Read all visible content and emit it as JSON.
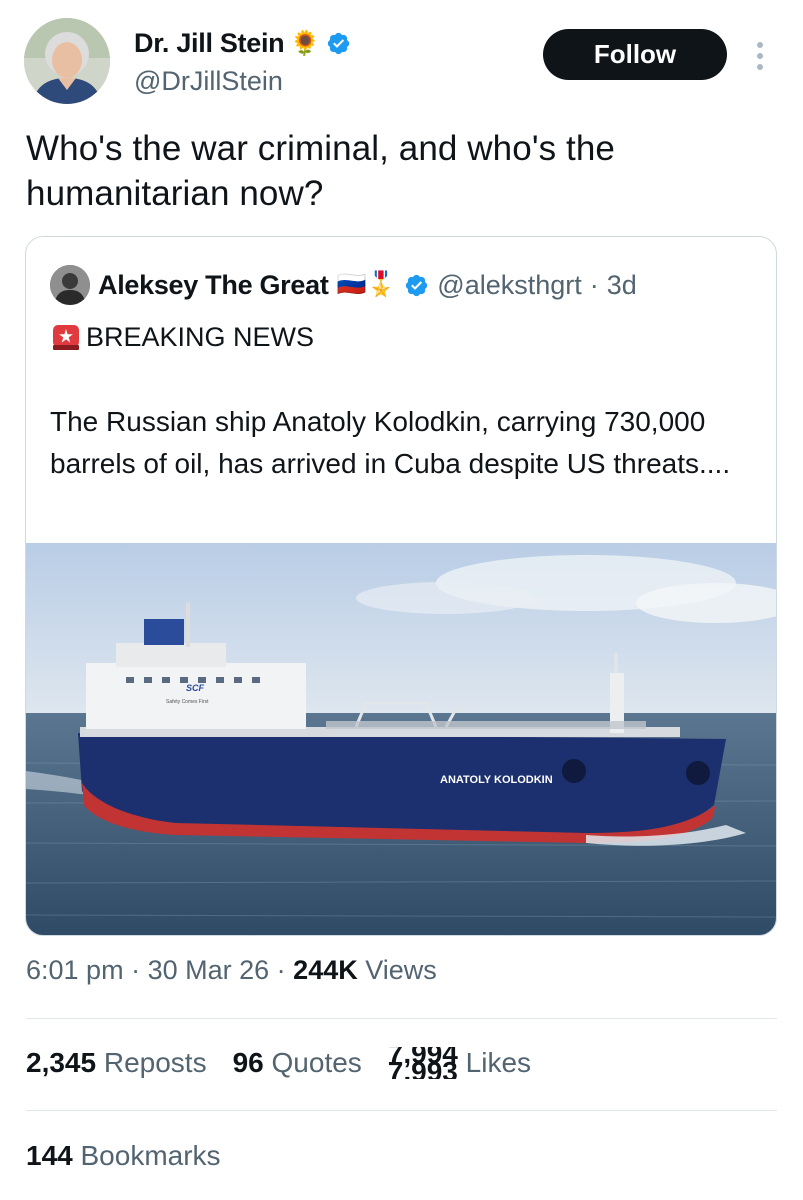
{
  "author": {
    "name": "Dr. Jill Stein",
    "name_emoji": "🌻",
    "handle": "@DrJillStein",
    "verified": true
  },
  "follow_label": "Follow",
  "tweet_text": "Who's the war criminal, and who's the humanitarian now?",
  "quoted": {
    "name": "Aleksey The Great",
    "name_emojis": "🇷🇺🎖️",
    "verified": true,
    "handle": "@aleksthgrt",
    "age": "3d",
    "heading_emoji": "🚨",
    "heading": "BREAKING NEWS",
    "body": "The Russian ship Anatoly Kolodkin, carrying 730,000 barrels of oil, has arrived in Cuba despite US threats....",
    "image_text": {
      "hull_name": "ANATOLY KOLODKIN",
      "funnel_brand": "SCF",
      "bridge_slogan": "Safety Comes First"
    }
  },
  "meta": {
    "time": "6:01 pm",
    "date": "30 Mar 26",
    "views_count": "244K",
    "views_label": "Views"
  },
  "stats": {
    "reposts_count": "2,345",
    "reposts_label": "Reposts",
    "quotes_count": "96",
    "quotes_label": "Quotes",
    "likes_count_prev": "7,994",
    "likes_count": "7,993",
    "likes_label": "Likes",
    "bookmarks_count": "144",
    "bookmarks_label": "Bookmarks"
  },
  "colors": {
    "verified_blue": "#1d9bf0",
    "text_primary": "#0f1419",
    "text_secondary": "#536471",
    "follow_bg": "#0f1419"
  },
  "icons": [
    "verified-badge-icon",
    "more-options-icon",
    "siren-icon"
  ]
}
